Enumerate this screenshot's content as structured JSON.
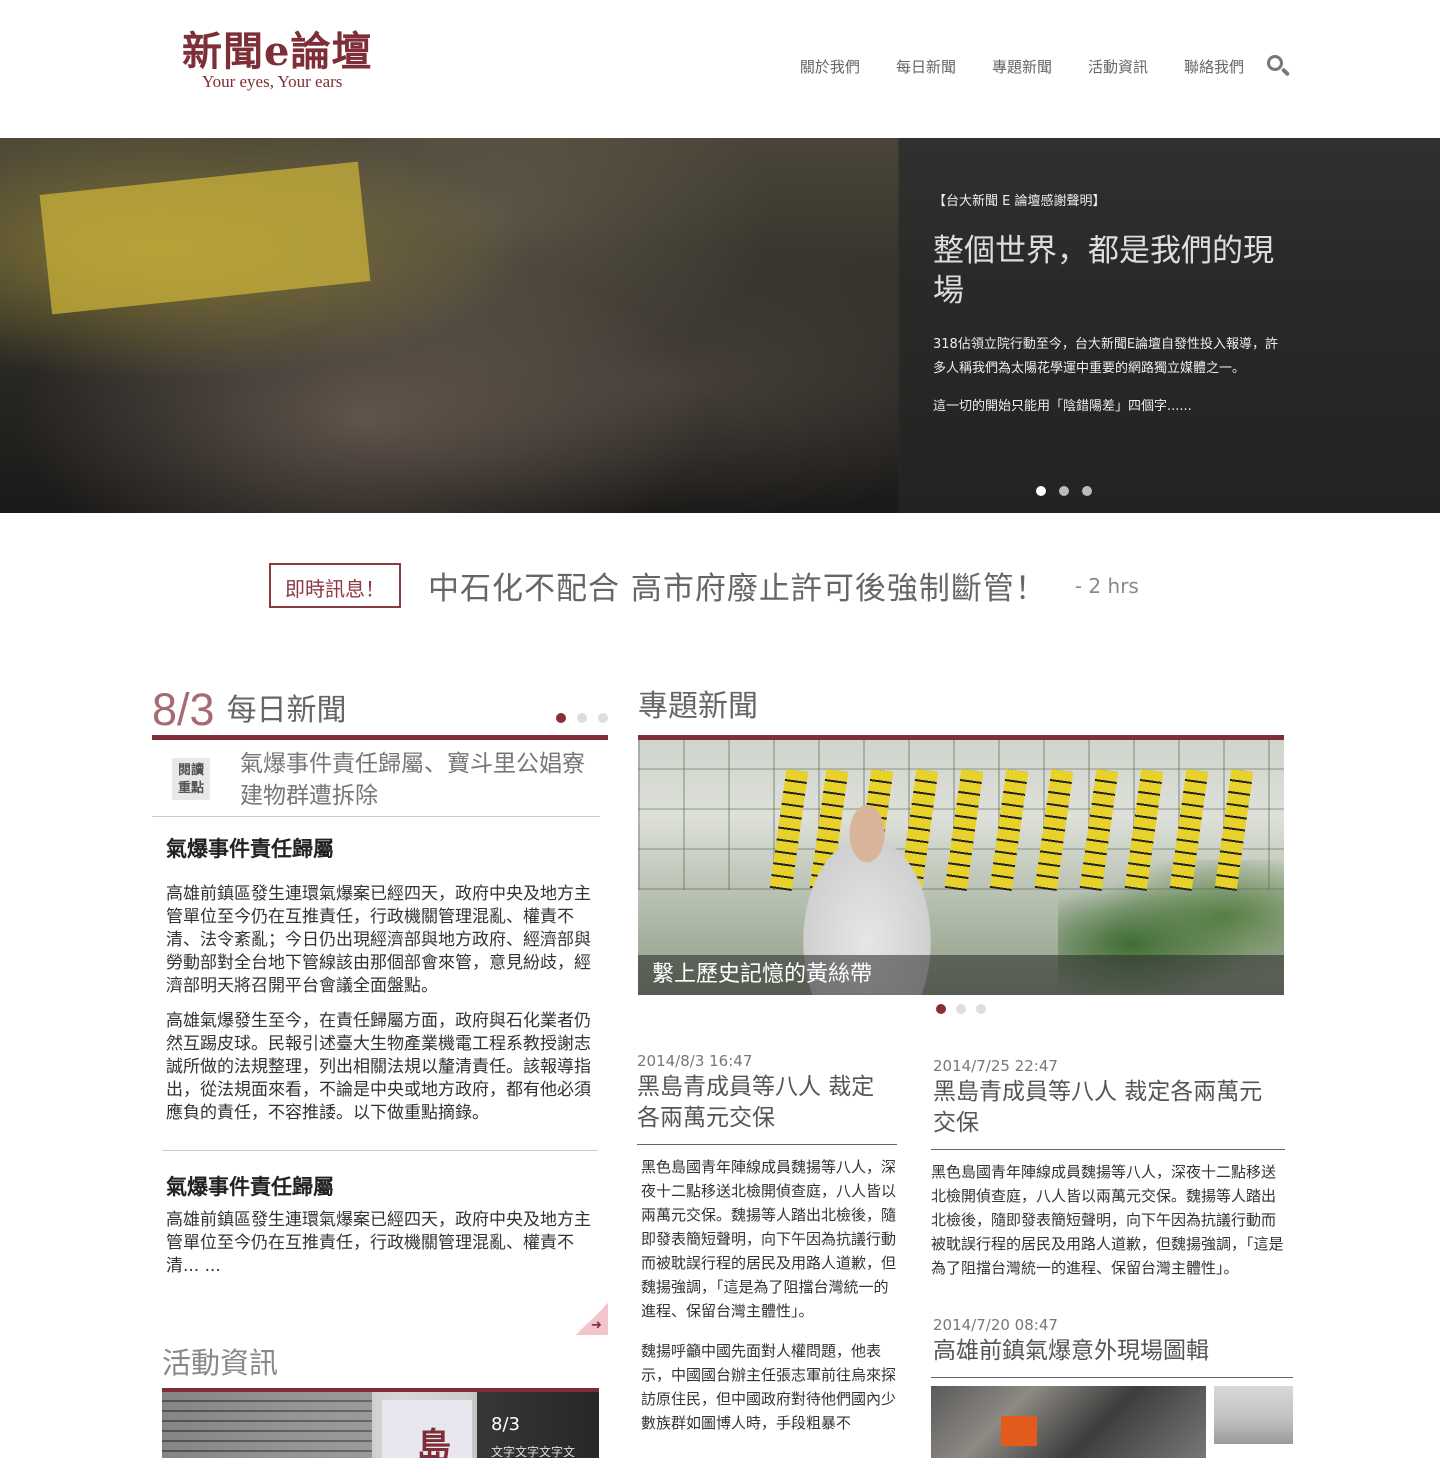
{
  "header": {
    "logo_title": "新聞e論壇",
    "logo_subtitle": "Your eyes, Your ears",
    "nav": [
      "關於我們",
      "每日新聞",
      "專題新聞",
      "活動資訊",
      "聯絡我們"
    ]
  },
  "hero": {
    "tag": "【台大新聞 E 論壇感謝聲明】",
    "title": "整個世界，都是我們的現場",
    "desc": "318佔領立院行動至今，台大新聞E論壇自發性投入報導，許多人稱我們為太陽花學運中重要的網路獨立媒體之一。",
    "more": "這一切的開始只能用「陰錯陽差」四個字......",
    "slides": 3,
    "active_slide": 1
  },
  "ticker": {
    "label": "即時訊息！",
    "text": "中石化不配合 高市府廢止許可後強制斷管！",
    "time": "- 2 hrs"
  },
  "daily": {
    "date": "8/3",
    "title": "每日新聞",
    "focus_badge": "閱讀重點",
    "focus_text": "氣爆事件責任歸屬、寶斗里公娼寮建物群遭拆除",
    "story1": {
      "headline": "氣爆事件責任歸屬",
      "para1": "高雄前鎮區發生連環氣爆案已經四天，政府中央及地方主管單位至今仍在互推責任，行政機關管理混亂、權責不清、法令紊亂；今日仍出現經濟部與地方政府、經濟部與勞動部對全台地下管線該由那個部會來管，意見紛歧，經濟部明天將召開平台會議全面盤點。",
      "para2": "高雄氣爆發生至今，在責任歸屬方面，政府與石化業者仍然互踢皮球。民報引述臺大生物產業機電工程系教授謝志誠所做的法規整理，列出相關法規以釐清責任。該報導指出，從法規面來看，不論是中央或地方政府，都有他必須應負的責任，不容推諉。以下做重點摘錄。"
    },
    "story2": {
      "headline": "氣爆事件責任歸屬",
      "body": "高雄前鎮區發生連環氣爆案已經四天，政府中央及地方主管單位至今仍在互推責任，行政機關管理混亂、權責不清... ..."
    }
  },
  "events": {
    "title": "活動資訊",
    "date": "8/3",
    "desc": "文字文字文字文",
    "flag_char": "島"
  },
  "special": {
    "title": "專題新聞",
    "caption": "繫上歷史記憶的黃絲帶",
    "articles": [
      {
        "date": "2014/8/3 16:47",
        "title": "黑島青成員等八人 裁定各兩萬元交保",
        "body": "黑色島國青年陣線成員魏揚等八人，深夜十二點移送北檢開偵查庭，八人皆以兩萬元交保。魏揚等人踏出北檢後，隨即發表簡短聲明，向下午因為抗議行動而被耽誤行程的居民及用路人道歉，但魏揚強調，「這是為了阻擋台灣統一的進程、保留台灣主體性」。",
        "body2": "魏揚呼籲中國先面對人權問題，他表示，中國國台辦主任張志軍前往烏來探訪原住民，但中國政府對待他們國內少數族群如圖博人時，手段粗暴不"
      },
      {
        "date": "2014/7/25 22:47",
        "title": "黑島青成員等八人 裁定各兩萬元交保",
        "body": "黑色島國青年陣線成員魏揚等八人，深夜十二點移送北檢開偵查庭，八人皆以兩萬元交保。魏揚等人踏出北檢後，隨即發表簡短聲明，向下午因為抗議行動而被耽誤行程的居民及用路人道歉，但魏揚強調，「這是為了阻擋台灣統一的進程、保留台灣主體性」。"
      },
      {
        "date": "2014/7/20 08:47",
        "title": "高雄前鎮氣爆意外現場圖輯"
      }
    ]
  },
  "colors": {
    "brand": "#7d2e36",
    "accent_dot": "#8b2c36"
  }
}
